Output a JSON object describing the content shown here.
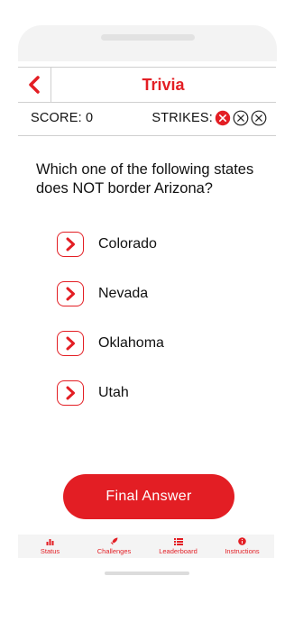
{
  "header": {
    "title": "Trivia",
    "back_icon": "chevron-left-icon"
  },
  "status": {
    "score_label": "SCORE: 0",
    "strikes_label": "STRIKES:",
    "strikes_used": 1,
    "strikes_total": 3
  },
  "question": "Which one of the following states does NOT border Arizona?",
  "options": [
    {
      "label": "Colorado",
      "icon": "chevron-right-icon"
    },
    {
      "label": "Nevada",
      "icon": "chevron-right-icon"
    },
    {
      "label": "Oklahoma",
      "icon": "chevron-right-icon"
    },
    {
      "label": "Utah",
      "icon": "chevron-right-icon"
    }
  ],
  "final_answer_label": "Final Answer",
  "bottom_nav": [
    {
      "label": "Status",
      "icon": "bar-chart-icon"
    },
    {
      "label": "Challenges",
      "icon": "rocket-icon"
    },
    {
      "label": "Leaderboard",
      "icon": "list-icon"
    },
    {
      "label": "Instructions",
      "icon": "info-icon"
    }
  ],
  "colors": {
    "accent": "#e31e24",
    "text": "#111111",
    "divider": "#cfcfcf"
  }
}
